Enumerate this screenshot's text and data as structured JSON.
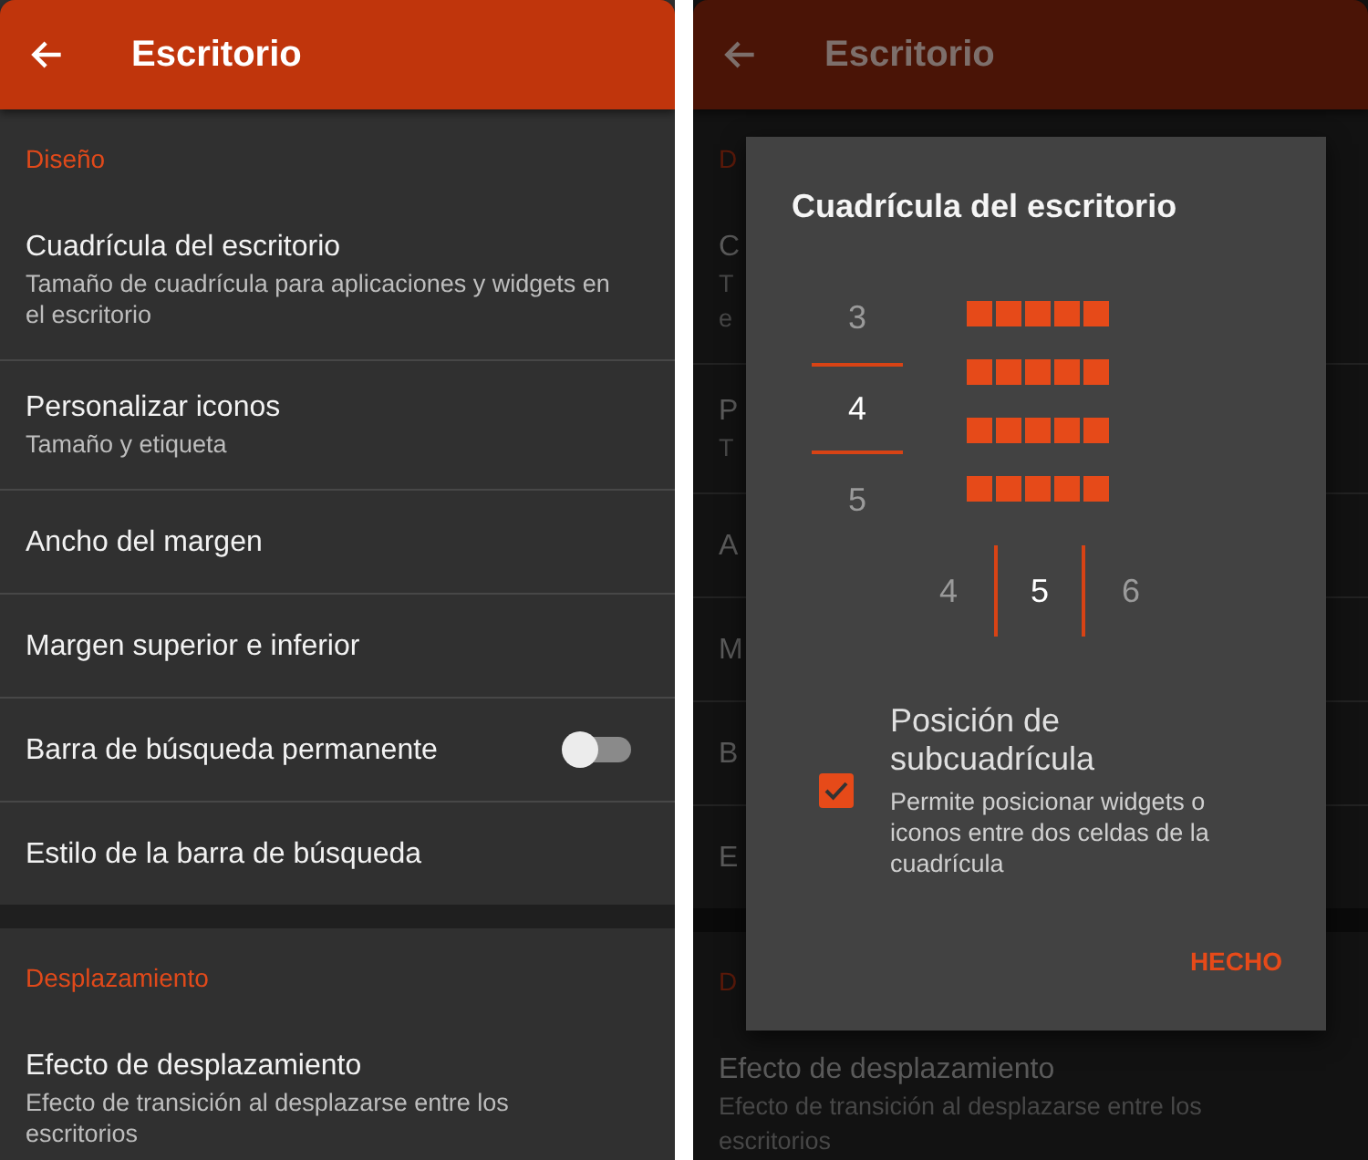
{
  "left_screen": {
    "header": {
      "back_icon": true,
      "title": "Escritorio"
    },
    "sections": [
      {
        "title": "Diseño",
        "items": [
          {
            "kind": "plain",
            "title": "Cuadrícula del escritorio",
            "subtitle": "Tamaño de cuadrícula para aplicaciones y widgets en el escritorio"
          },
          {
            "kind": "plain",
            "title": "Personalizar iconos",
            "subtitle": "Tamaño y etiqueta"
          },
          {
            "kind": "plain",
            "title": "Ancho del margen"
          },
          {
            "kind": "plain",
            "title": "Margen superior e inferior"
          },
          {
            "kind": "toggle",
            "title": "Barra de búsqueda permanente",
            "on": false
          },
          {
            "kind": "plain",
            "title": "Estilo de la barra de búsqueda"
          }
        ]
      },
      {
        "title": "Desplazamiento",
        "items": [
          {
            "kind": "plain",
            "title": "Efecto de desplazamiento",
            "subtitle": "Efecto de transición al desplazarse entre los escritorios"
          }
        ]
      }
    ]
  },
  "right_screen": {
    "header": {
      "title": "Escritorio"
    },
    "sections": [
      {
        "title": "D",
        "items": [
          {
            "title": "C",
            "subtitle_lines": [
              "T",
              "e"
            ]
          },
          {
            "title": "P",
            "subtitle_lines": [
              "T"
            ]
          },
          {
            "title": "A"
          },
          {
            "title": "M"
          },
          {
            "title": "B"
          },
          {
            "title": "E"
          }
        ]
      },
      {
        "title": "D",
        "items": [
          {
            "title": "Efecto de desplazamiento",
            "subtitle_lines": [
              "Efecto de transición al desplazarse entre los",
              "escritorios"
            ]
          }
        ]
      }
    ],
    "dialog": {
      "title": "Cuadrícula del escritorio",
      "rows_picker": [
        {
          "label": "3",
          "selected": false
        },
        {
          "label": "4",
          "selected": true
        },
        {
          "label": "5",
          "selected": false
        }
      ],
      "columns_picker": [
        {
          "label": "4",
          "selected": false
        },
        {
          "label": "5",
          "selected": true
        },
        {
          "label": "6",
          "selected": false
        }
      ],
      "option": {
        "title": "Posición de subcuadrícula",
        "description": "Permite posicionar widgets o iconos entre dos celdas de la cuadrícula",
        "checked": true
      },
      "button": "HECHO"
    }
  }
}
